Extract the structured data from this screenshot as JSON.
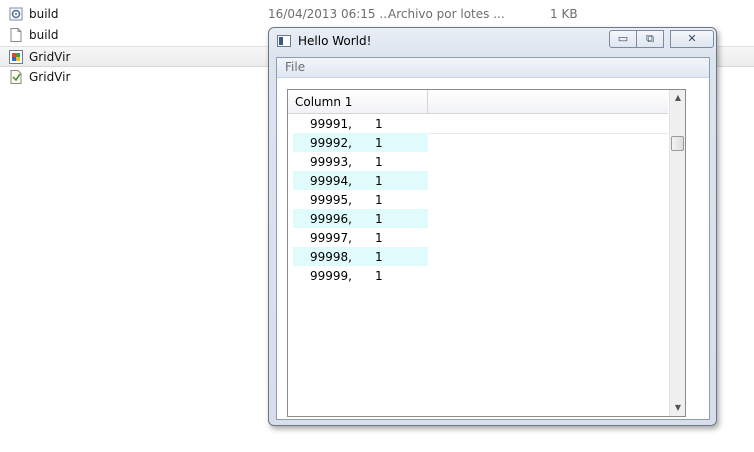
{
  "explorer": {
    "files": [
      {
        "name": "build",
        "date": "16/04/2013 06:15 ...",
        "type": "Archivo por lotes ...",
        "size": "1 KB",
        "icon": "batch-file-icon"
      },
      {
        "name": "build",
        "date": "",
        "type": "",
        "size": "",
        "icon": "text-file-icon"
      },
      {
        "name": "GridVir",
        "date": "",
        "type": "",
        "size": "",
        "icon": "application-icon",
        "selected": true
      },
      {
        "name": "GridVir",
        "date": "",
        "type": "",
        "size": "",
        "icon": "manifest-file-icon"
      }
    ]
  },
  "window": {
    "title": "Hello World!",
    "controls": {
      "minimize": "▭",
      "maximize": "⧉",
      "close": "✕"
    },
    "menu": {
      "file": "File"
    },
    "grid": {
      "header": "Column 1",
      "rows": [
        {
          "a": "99991,",
          "b": "1"
        },
        {
          "a": "99992,",
          "b": "1"
        },
        {
          "a": "99993,",
          "b": "1"
        },
        {
          "a": "99994,",
          "b": "1"
        },
        {
          "a": "99995,",
          "b": "1"
        },
        {
          "a": "99996,",
          "b": "1"
        },
        {
          "a": "99997,",
          "b": "1"
        },
        {
          "a": "99998,",
          "b": "1"
        },
        {
          "a": "99999,",
          "b": "1"
        }
      ],
      "scroll_up": "▲",
      "scroll_down": "▼"
    }
  },
  "colors": {
    "alt_row": "#dffbfb",
    "accent": "#3a5a8c"
  }
}
